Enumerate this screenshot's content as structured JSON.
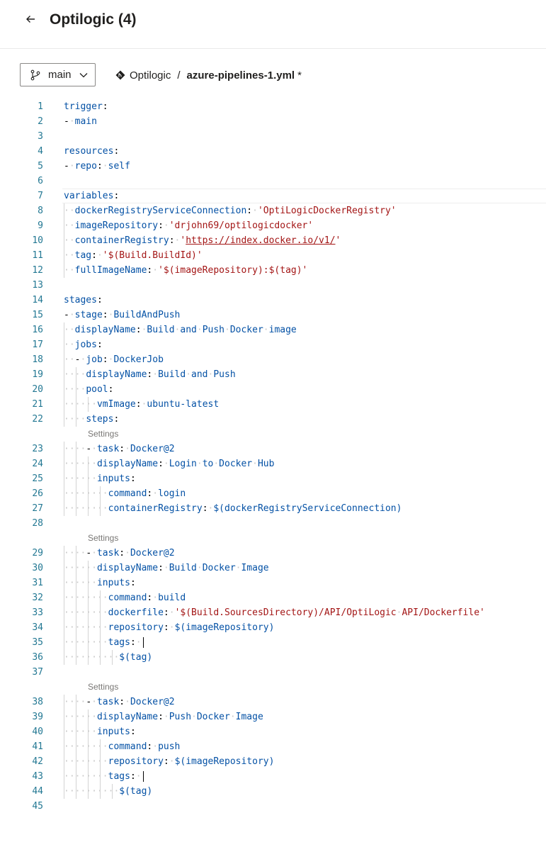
{
  "header": {
    "title": "Optilogic (4)"
  },
  "toolbar": {
    "branch": "main",
    "repo": "Optilogic",
    "separator": "/",
    "file": "azure-pipelines-1.yml",
    "dirty": "*"
  },
  "editor": {
    "settings_label": "Settings",
    "lines": [
      {
        "n": "1",
        "indent": 0,
        "tokens": [
          [
            "k",
            "trigger"
          ],
          [
            "p",
            ":"
          ]
        ]
      },
      {
        "n": "2",
        "indent": 0,
        "tokens": [
          [
            "p",
            "-"
          ],
          [
            "ws",
            "·"
          ],
          [
            "v",
            "main"
          ]
        ]
      },
      {
        "n": "3",
        "indent": 0,
        "tokens": []
      },
      {
        "n": "4",
        "indent": 0,
        "tokens": [
          [
            "k",
            "resources"
          ],
          [
            "p",
            ":"
          ]
        ]
      },
      {
        "n": "5",
        "indent": 0,
        "tokens": [
          [
            "p",
            "-"
          ],
          [
            "ws",
            "·"
          ],
          [
            "k",
            "repo"
          ],
          [
            "p",
            ":"
          ],
          [
            "ws",
            "·"
          ],
          [
            "v",
            "self"
          ]
        ]
      },
      {
        "n": "6",
        "indent": 0,
        "tokens": []
      },
      {
        "n": "7",
        "indent": 0,
        "tokens": [
          [
            "k",
            "variables"
          ],
          [
            "p",
            ":"
          ]
        ]
      },
      {
        "n": "8",
        "indent": 1,
        "tokens": [
          [
            "k",
            "dockerRegistryServiceConnection"
          ],
          [
            "p",
            ":"
          ],
          [
            "ws",
            "·"
          ],
          [
            "s",
            "'OptiLogicDockerRegistry'"
          ]
        ]
      },
      {
        "n": "9",
        "indent": 1,
        "tokens": [
          [
            "k",
            "imageRepository"
          ],
          [
            "p",
            ":"
          ],
          [
            "ws",
            "·"
          ],
          [
            "s",
            "'drjohn69/optilogicdocker'"
          ]
        ]
      },
      {
        "n": "10",
        "indent": 1,
        "tokens": [
          [
            "k",
            "containerRegistry"
          ],
          [
            "p",
            ":"
          ],
          [
            "ws",
            "·"
          ],
          [
            "s",
            "'"
          ],
          [
            "u",
            "https://index.docker.io/v1/"
          ],
          [
            "s",
            "'"
          ]
        ]
      },
      {
        "n": "11",
        "indent": 1,
        "tokens": [
          [
            "k",
            "tag"
          ],
          [
            "p",
            ":"
          ],
          [
            "ws",
            "·"
          ],
          [
            "s",
            "'$(Build.BuildId)'"
          ]
        ]
      },
      {
        "n": "12",
        "indent": 1,
        "tokens": [
          [
            "k",
            "fullImageName"
          ],
          [
            "p",
            ":"
          ],
          [
            "ws",
            "·"
          ],
          [
            "s",
            "'$(imageRepository):$(tag)'"
          ]
        ]
      },
      {
        "n": "13",
        "indent": 0,
        "tokens": []
      },
      {
        "n": "14",
        "indent": 0,
        "tokens": [
          [
            "k",
            "stages"
          ],
          [
            "p",
            ":"
          ]
        ]
      },
      {
        "n": "15",
        "indent": 0,
        "tokens": [
          [
            "p",
            "-"
          ],
          [
            "ws",
            "·"
          ],
          [
            "k",
            "stage"
          ],
          [
            "p",
            ":"
          ],
          [
            "ws",
            "·"
          ],
          [
            "v",
            "BuildAndPush"
          ]
        ]
      },
      {
        "n": "16",
        "indent": 1,
        "tokens": [
          [
            "k",
            "displayName"
          ],
          [
            "p",
            ":"
          ],
          [
            "ws",
            "·"
          ],
          [
            "v",
            "Build"
          ],
          [
            "ws",
            "·"
          ],
          [
            "v",
            "and"
          ],
          [
            "ws",
            "·"
          ],
          [
            "v",
            "Push"
          ],
          [
            "ws",
            "·"
          ],
          [
            "v",
            "Docker"
          ],
          [
            "ws",
            "·"
          ],
          [
            "v",
            "image"
          ]
        ]
      },
      {
        "n": "17",
        "indent": 1,
        "tokens": [
          [
            "k",
            "jobs"
          ],
          [
            "p",
            ":"
          ]
        ]
      },
      {
        "n": "18",
        "indent": 1,
        "tokens": [
          [
            "p",
            "-"
          ],
          [
            "ws",
            "·"
          ],
          [
            "k",
            "job"
          ],
          [
            "p",
            ":"
          ],
          [
            "ws",
            "·"
          ],
          [
            "v",
            "DockerJob"
          ]
        ]
      },
      {
        "n": "19",
        "indent": 2,
        "tokens": [
          [
            "k",
            "displayName"
          ],
          [
            "p",
            ":"
          ],
          [
            "ws",
            "·"
          ],
          [
            "v",
            "Build"
          ],
          [
            "ws",
            "·"
          ],
          [
            "v",
            "and"
          ],
          [
            "ws",
            "·"
          ],
          [
            "v",
            "Push"
          ]
        ]
      },
      {
        "n": "20",
        "indent": 2,
        "tokens": [
          [
            "k",
            "pool"
          ],
          [
            "p",
            ":"
          ]
        ]
      },
      {
        "n": "21",
        "indent": 3,
        "tokens": [
          [
            "k",
            "vmImage"
          ],
          [
            "p",
            ":"
          ],
          [
            "ws",
            "·"
          ],
          [
            "v",
            "ubuntu-latest"
          ]
        ]
      },
      {
        "n": "22",
        "indent": 2,
        "tokens": [
          [
            "k",
            "steps"
          ],
          [
            "p",
            ":"
          ]
        ]
      },
      {
        "n": "23",
        "indent": 2,
        "settings": true,
        "tokens": [
          [
            "p",
            "-"
          ],
          [
            "ws",
            "·"
          ],
          [
            "k",
            "task"
          ],
          [
            "p",
            ":"
          ],
          [
            "ws",
            "·"
          ],
          [
            "v",
            "Docker@2"
          ]
        ]
      },
      {
        "n": "24",
        "indent": 3,
        "tokens": [
          [
            "k",
            "displayName"
          ],
          [
            "p",
            ":"
          ],
          [
            "ws",
            "·"
          ],
          [
            "v",
            "Login"
          ],
          [
            "ws",
            "·"
          ],
          [
            "v",
            "to"
          ],
          [
            "ws",
            "·"
          ],
          [
            "v",
            "Docker"
          ],
          [
            "ws",
            "·"
          ],
          [
            "v",
            "Hub"
          ]
        ]
      },
      {
        "n": "25",
        "indent": 3,
        "tokens": [
          [
            "k",
            "inputs"
          ],
          [
            "p",
            ":"
          ]
        ]
      },
      {
        "n": "26",
        "indent": 4,
        "tokens": [
          [
            "k",
            "command"
          ],
          [
            "p",
            ":"
          ],
          [
            "ws",
            "·"
          ],
          [
            "v",
            "login"
          ]
        ]
      },
      {
        "n": "27",
        "indent": 4,
        "tokens": [
          [
            "k",
            "containerRegistry"
          ],
          [
            "p",
            ":"
          ],
          [
            "ws",
            "·"
          ],
          [
            "v",
            "$(dockerRegistryServiceConnection)"
          ]
        ]
      },
      {
        "n": "28",
        "indent": 0,
        "tokens": []
      },
      {
        "n": "29",
        "indent": 2,
        "settings": true,
        "tokens": [
          [
            "p",
            "-"
          ],
          [
            "ws",
            "·"
          ],
          [
            "k",
            "task"
          ],
          [
            "p",
            ":"
          ],
          [
            "ws",
            "·"
          ],
          [
            "v",
            "Docker@2"
          ]
        ]
      },
      {
        "n": "30",
        "indent": 3,
        "tokens": [
          [
            "k",
            "displayName"
          ],
          [
            "p",
            ":"
          ],
          [
            "ws",
            "·"
          ],
          [
            "v",
            "Build"
          ],
          [
            "ws",
            "·"
          ],
          [
            "v",
            "Docker"
          ],
          [
            "ws",
            "·"
          ],
          [
            "v",
            "Image"
          ]
        ]
      },
      {
        "n": "31",
        "indent": 3,
        "tokens": [
          [
            "k",
            "inputs"
          ],
          [
            "p",
            ":"
          ]
        ]
      },
      {
        "n": "32",
        "indent": 4,
        "tokens": [
          [
            "k",
            "command"
          ],
          [
            "p",
            ":"
          ],
          [
            "ws",
            "·"
          ],
          [
            "v",
            "build"
          ]
        ]
      },
      {
        "n": "33",
        "indent": 4,
        "tokens": [
          [
            "k",
            "dockerfile"
          ],
          [
            "p",
            ":"
          ],
          [
            "ws",
            "·"
          ],
          [
            "s",
            "'$(Build.SourcesDirectory)/API/OptiLogic"
          ],
          [
            "ws",
            "·"
          ],
          [
            "s",
            "API/Dockerfile'"
          ]
        ]
      },
      {
        "n": "34",
        "indent": 4,
        "tokens": [
          [
            "k",
            "repository"
          ],
          [
            "p",
            ":"
          ],
          [
            "ws",
            "·"
          ],
          [
            "v",
            "$(imageRepository)"
          ]
        ]
      },
      {
        "n": "35",
        "indent": 4,
        "cursor": true,
        "tokens": [
          [
            "k",
            "tags"
          ],
          [
            "p",
            ":"
          ],
          [
            "ws",
            "·"
          ]
        ]
      },
      {
        "n": "36",
        "indent": 5,
        "tokens": [
          [
            "v",
            "$(tag)"
          ]
        ]
      },
      {
        "n": "37",
        "indent": 0,
        "tokens": []
      },
      {
        "n": "38",
        "indent": 2,
        "settings": true,
        "tokens": [
          [
            "p",
            "-"
          ],
          [
            "ws",
            "·"
          ],
          [
            "k",
            "task"
          ],
          [
            "p",
            ":"
          ],
          [
            "ws",
            "·"
          ],
          [
            "v",
            "Docker@2"
          ]
        ]
      },
      {
        "n": "39",
        "indent": 3,
        "tokens": [
          [
            "k",
            "displayName"
          ],
          [
            "p",
            ":"
          ],
          [
            "ws",
            "·"
          ],
          [
            "v",
            "Push"
          ],
          [
            "ws",
            "·"
          ],
          [
            "v",
            "Docker"
          ],
          [
            "ws",
            "·"
          ],
          [
            "v",
            "Image"
          ]
        ]
      },
      {
        "n": "40",
        "indent": 3,
        "tokens": [
          [
            "k",
            "inputs"
          ],
          [
            "p",
            ":"
          ]
        ]
      },
      {
        "n": "41",
        "indent": 4,
        "tokens": [
          [
            "k",
            "command"
          ],
          [
            "p",
            ":"
          ],
          [
            "ws",
            "·"
          ],
          [
            "v",
            "push"
          ]
        ]
      },
      {
        "n": "42",
        "indent": 4,
        "tokens": [
          [
            "k",
            "repository"
          ],
          [
            "p",
            ":"
          ],
          [
            "ws",
            "·"
          ],
          [
            "v",
            "$(imageRepository)"
          ]
        ]
      },
      {
        "n": "43",
        "indent": 4,
        "cursor": true,
        "tokens": [
          [
            "k",
            "tags"
          ],
          [
            "p",
            ":"
          ],
          [
            "ws",
            "·"
          ]
        ]
      },
      {
        "n": "44",
        "indent": 5,
        "tokens": [
          [
            "v",
            "$(tag)"
          ]
        ]
      },
      {
        "n": "45",
        "indent": 0,
        "tokens": []
      }
    ]
  }
}
